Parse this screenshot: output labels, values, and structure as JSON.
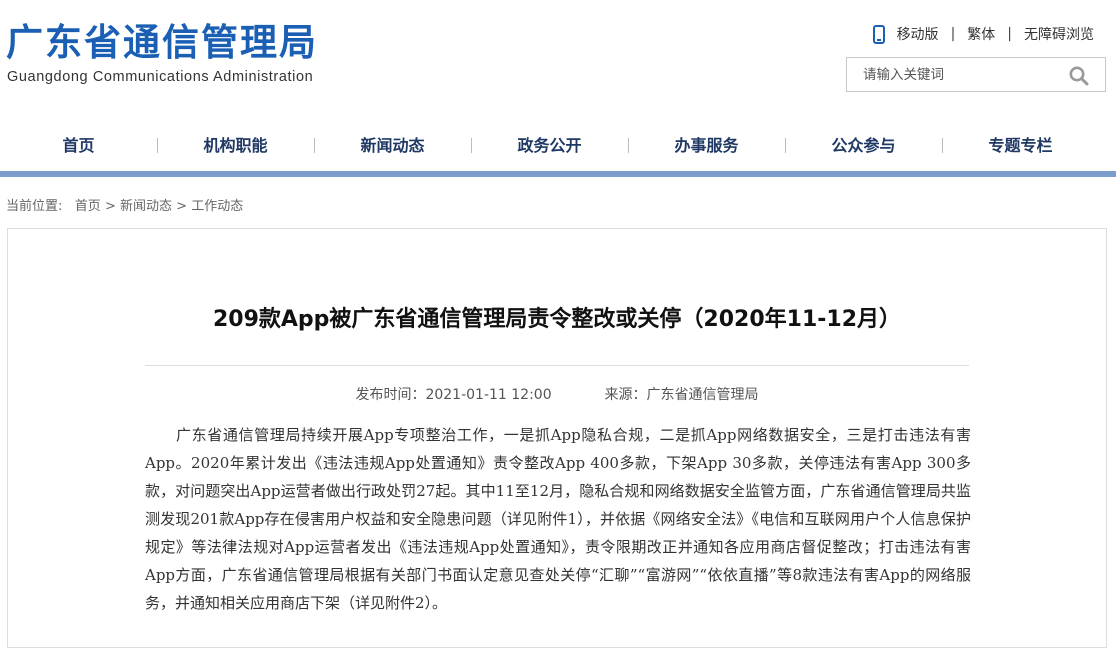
{
  "header": {
    "logo_cn": "广东省通信管理局",
    "logo_en": "Guangdong Communications Administration",
    "links": {
      "mobile": "移动版",
      "traditional": "繁体",
      "accessible": "无障碍浏览"
    },
    "search": {
      "placeholder": "请输入关键词"
    }
  },
  "nav": {
    "items": [
      "首页",
      "机构职能",
      "新闻动态",
      "政务公开",
      "办事服务",
      "公众参与",
      "专题专栏"
    ]
  },
  "breadcrumb": {
    "prefix": "当前位置:",
    "items": [
      "首页",
      "新闻动态",
      "工作动态"
    ],
    "separator": ">"
  },
  "article": {
    "title": "209款App被广东省通信管理局责令整改或关停（2020年11-12月）",
    "publish_label": "发布时间：2021-01-11 12:00",
    "source_label": "来源：广东省通信管理局",
    "body": "广东省通信管理局持续开展App专项整治工作，一是抓App隐私合规，二是抓App网络数据安全，三是打击违法有害App。2020年累计发出《违法违规App处置通知》责令整改App 400多款，下架App 30多款，关停违法有害App 300多款，对问题突出App运营者做出行政处罚27起。其中11至12月，隐私合规和网络数据安全监管方面，广东省通信管理局共监测发现201款App存在侵害用户权益和安全隐患问题（详见附件1），并依据《网络安全法》《电信和互联网用户个人信息保护规定》等法律法规对App运营者发出《违法违规App处置通知》，责令限期改正并通知各应用商店督促整改；打击违法有害App方面，广东省通信管理局根据有关部门书面认定意见查处关停“汇聊”“富游网”“依依直播”等8款违法有害App的网络服务，并通知相关应用商店下架（详见附件2）。"
  },
  "colors": {
    "brand": "#1a5fb4",
    "nav_text": "#1f3864",
    "nav_bar": "#7c9ccc"
  }
}
